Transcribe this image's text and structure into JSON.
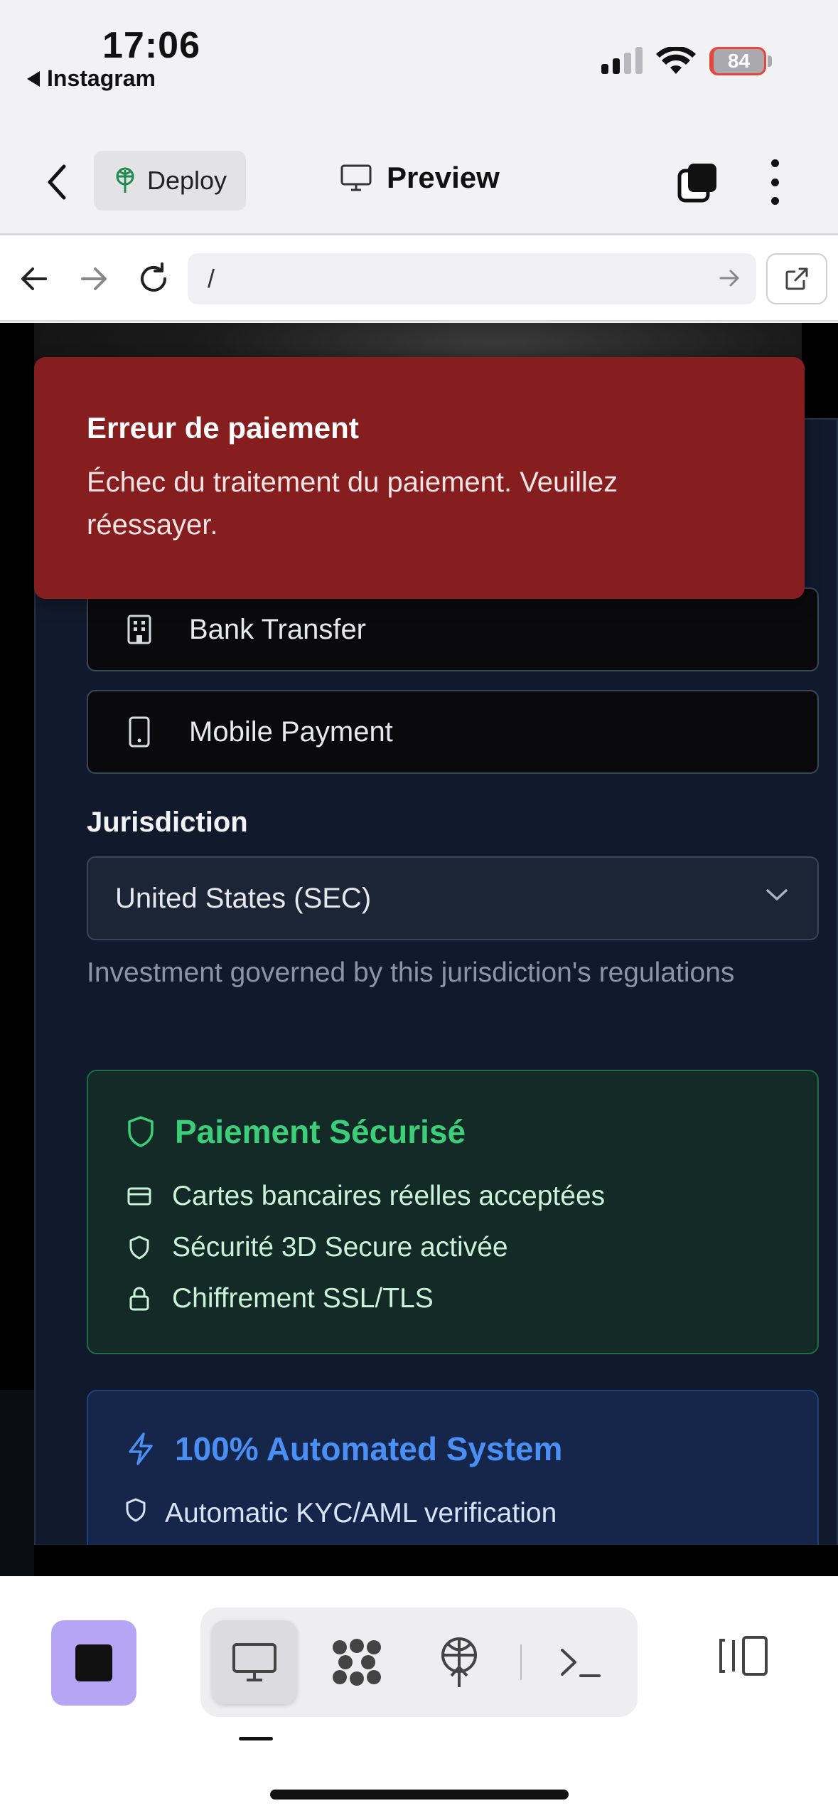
{
  "status_bar": {
    "time": "17:06",
    "back_app": "Instagram",
    "battery": "84"
  },
  "toolbar": {
    "deploy_label": "Deploy",
    "preview_label": "Preview"
  },
  "browser": {
    "url": "/"
  },
  "payment_methods": [
    {
      "label": "Bank Transfer",
      "icon": "building-icon"
    },
    {
      "label": "Mobile Payment",
      "icon": "smartphone-icon"
    }
  ],
  "jurisdiction": {
    "label": "Jurisdiction",
    "selected": "United States (SEC)",
    "help": "Investment governed by this jurisdiction's regulations"
  },
  "secure_payment": {
    "title": "Paiement Sécurisé",
    "items": [
      {
        "text": "Cartes bancaires réelles acceptées",
        "icon": "credit-card-icon"
      },
      {
        "text": "Sécurité 3D Secure activée",
        "icon": "shield-icon"
      },
      {
        "text": "Chiffrement SSL/TLS",
        "icon": "lock-icon"
      }
    ],
    "color": "#3ccf79"
  },
  "automated": {
    "title": "100% Automated System",
    "items": [
      {
        "text": "Automatic KYC/AML verification",
        "icon": "shield-icon"
      }
    ],
    "color": "#4a8ff3"
  },
  "toast": {
    "title": "Erreur de paiement",
    "message": "Échec du traitement du paiement. Veuillez réessayer.",
    "color": "#861e1f"
  },
  "dock": {
    "items": [
      "preview-icon",
      "graph-icon",
      "deploy-icon",
      "terminal-icon"
    ],
    "active": "preview-icon",
    "accent": "#b4a6f5"
  }
}
